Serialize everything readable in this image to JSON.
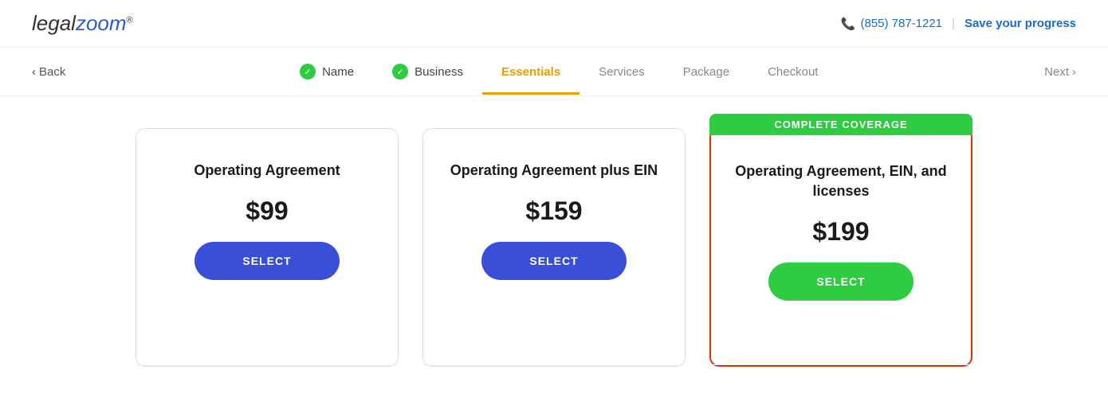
{
  "header": {
    "logo_legal": "legal",
    "logo_zoom": "zoom",
    "logo_trademark": "®",
    "phone": "(855) 787-1221",
    "save_progress": "Save your progress"
  },
  "nav": {
    "back_label": "Back",
    "next_label": "Next",
    "steps": [
      {
        "id": "name",
        "label": "Name",
        "completed": true,
        "active": false
      },
      {
        "id": "business",
        "label": "Business",
        "completed": true,
        "active": false
      },
      {
        "id": "essentials",
        "label": "Essentials",
        "completed": false,
        "active": true
      },
      {
        "id": "services",
        "label": "Services",
        "completed": false,
        "active": false
      },
      {
        "id": "package",
        "label": "Package",
        "completed": false,
        "active": false
      },
      {
        "id": "checkout",
        "label": "Checkout",
        "completed": false,
        "active": false
      }
    ]
  },
  "cards": [
    {
      "id": "card1",
      "title": "Operating Agreement",
      "price": "$99",
      "button_label": "SELECT",
      "featured": false,
      "badge": null
    },
    {
      "id": "card2",
      "title": "Operating Agreement plus EIN",
      "price": "$159",
      "button_label": "SELECT",
      "featured": false,
      "badge": null
    },
    {
      "id": "card3",
      "title": "Operating Agreement, EIN, and licenses",
      "price": "$199",
      "button_label": "SELECT",
      "featured": true,
      "badge": "COMPLETE COVERAGE"
    }
  ]
}
